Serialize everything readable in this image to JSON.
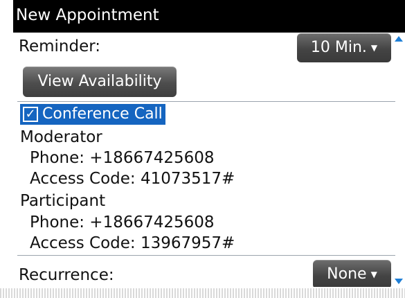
{
  "title": "New Appointment",
  "reminder": {
    "label": "Reminder:",
    "value": "10 Min."
  },
  "view_availability_label": "View Availability",
  "conference": {
    "label": "Conference Call",
    "checked": true,
    "moderator": {
      "heading": "Moderator",
      "phone": "Phone: +18667425608",
      "access_code": "Access Code: 41073517#"
    },
    "participant": {
      "heading": "Participant",
      "phone": "Phone: +18667425608",
      "access_code": "Access Code: 13967957#"
    }
  },
  "recurrence": {
    "label": "Recurrence:",
    "value": "None"
  },
  "icons": {
    "caret": "chevron-down-icon",
    "check": "checkmark-icon"
  },
  "colors": {
    "selection": "#1565c0",
    "scroll_arrow": "#1f7fd6"
  }
}
